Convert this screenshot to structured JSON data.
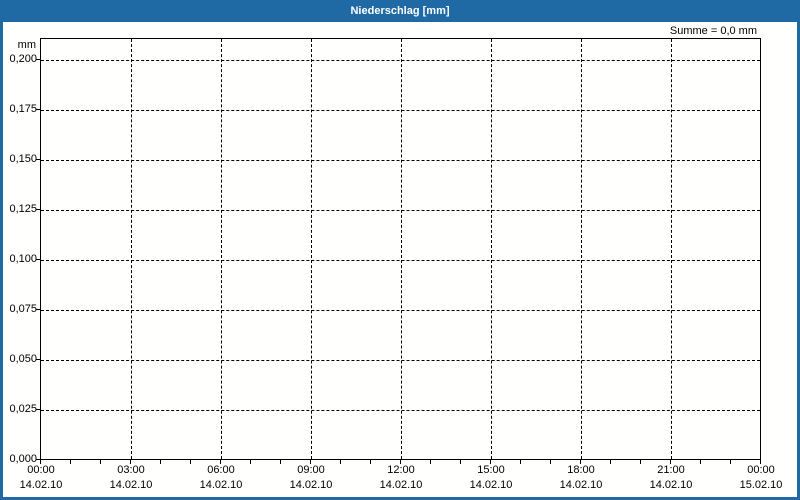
{
  "window": {
    "title": "Niederschlag [mm]",
    "colors": {
      "titlebar_bg": "#1f6aa5",
      "titlebar_text": "#ffffff",
      "outer_border": "#1f6aa5",
      "plot_border": "#000000",
      "grid": "#000000",
      "text": "#000000",
      "background": "#fffffe"
    }
  },
  "summary": {
    "text": "Summe = 0,0 mm"
  },
  "chart_data": {
    "type": "line",
    "title": "Niederschlag [mm]",
    "xlabel": "",
    "ylabel": "mm",
    "ylim": [
      0.0,
      0.2
    ],
    "grid": true,
    "annotation": "Summe = 0,0 mm",
    "yticks": [
      {
        "value": 0.2,
        "label": "0,200"
      },
      {
        "value": 0.175,
        "label": "0,175"
      },
      {
        "value": 0.15,
        "label": "0,150"
      },
      {
        "value": 0.125,
        "label": "0,125"
      },
      {
        "value": 0.1,
        "label": "0,100"
      },
      {
        "value": 0.075,
        "label": "0,075"
      },
      {
        "value": 0.05,
        "label": "0,050"
      },
      {
        "value": 0.025,
        "label": "0,025"
      },
      {
        "value": 0.0,
        "label": "0,000"
      }
    ],
    "xticks": [
      {
        "hour": 0,
        "time": "00:00",
        "date": "14.02.10"
      },
      {
        "hour": 3,
        "time": "03:00",
        "date": "14.02.10"
      },
      {
        "hour": 6,
        "time": "06:00",
        "date": "14.02.10"
      },
      {
        "hour": 9,
        "time": "09:00",
        "date": "14.02.10"
      },
      {
        "hour": 12,
        "time": "12:00",
        "date": "14.02.10"
      },
      {
        "hour": 15,
        "time": "15:00",
        "date": "14.02.10"
      },
      {
        "hour": 18,
        "time": "18:00",
        "date": "14.02.10"
      },
      {
        "hour": 21,
        "time": "21:00",
        "date": "14.02.10"
      },
      {
        "hour": 24,
        "time": "00:00",
        "date": "15.02.10"
      }
    ],
    "x_range_hours": [
      0,
      24
    ],
    "x_minor_step_hours": 1,
    "series": [
      {
        "name": "Niederschlag",
        "values": []
      }
    ]
  }
}
